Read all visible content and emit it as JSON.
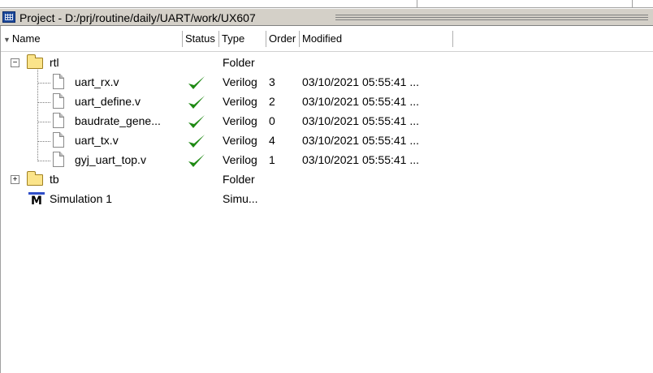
{
  "window": {
    "title": "Project - D:/prj/routine/daily/UART/work/UX607"
  },
  "columns": [
    {
      "label": "Name"
    },
    {
      "label": "Status"
    },
    {
      "label": "Type"
    },
    {
      "label": "Order"
    },
    {
      "label": "Modified"
    }
  ],
  "rows": [
    {
      "name": "rtl",
      "status": "",
      "type": "Folder",
      "order": "",
      "modified": "",
      "kind": "folder",
      "expanded": true
    },
    {
      "name": "uart_rx.v",
      "status": "ok",
      "type": "Verilog",
      "order": "3",
      "modified": "03/10/2021 05:55:41 ...",
      "kind": "file"
    },
    {
      "name": "uart_define.v",
      "status": "ok",
      "type": "Verilog",
      "order": "2",
      "modified": "03/10/2021 05:55:41 ...",
      "kind": "file"
    },
    {
      "name": "baudrate_gene...",
      "status": "ok",
      "type": "Verilog",
      "order": "0",
      "modified": "03/10/2021 05:55:41 ...",
      "kind": "file"
    },
    {
      "name": "uart_tx.v",
      "status": "ok",
      "type": "Verilog",
      "order": "4",
      "modified": "03/10/2021 05:55:41 ...",
      "kind": "file"
    },
    {
      "name": "gyj_uart_top.v",
      "status": "ok",
      "type": "Verilog",
      "order": "1",
      "modified": "03/10/2021 05:55:41 ...",
      "kind": "file"
    },
    {
      "name": "tb",
      "status": "",
      "type": "Folder",
      "order": "",
      "modified": "",
      "kind": "folder",
      "expanded": false
    },
    {
      "name": "Simulation 1",
      "status": "",
      "type": "Simu...",
      "order": "",
      "modified": "",
      "kind": "simulation"
    }
  ],
  "icons": {
    "title": "project-window-icon",
    "status_ok": "green-check-icon",
    "folder": "folder-icon",
    "file": "file-icon",
    "simulation": "modelsim-icon"
  },
  "colors": {
    "check_green": "#1f8a14",
    "folder_fill": "#fbe48a",
    "sim_bar": "#2f4ec8",
    "titlebar_bg": "#d4d0c8"
  }
}
